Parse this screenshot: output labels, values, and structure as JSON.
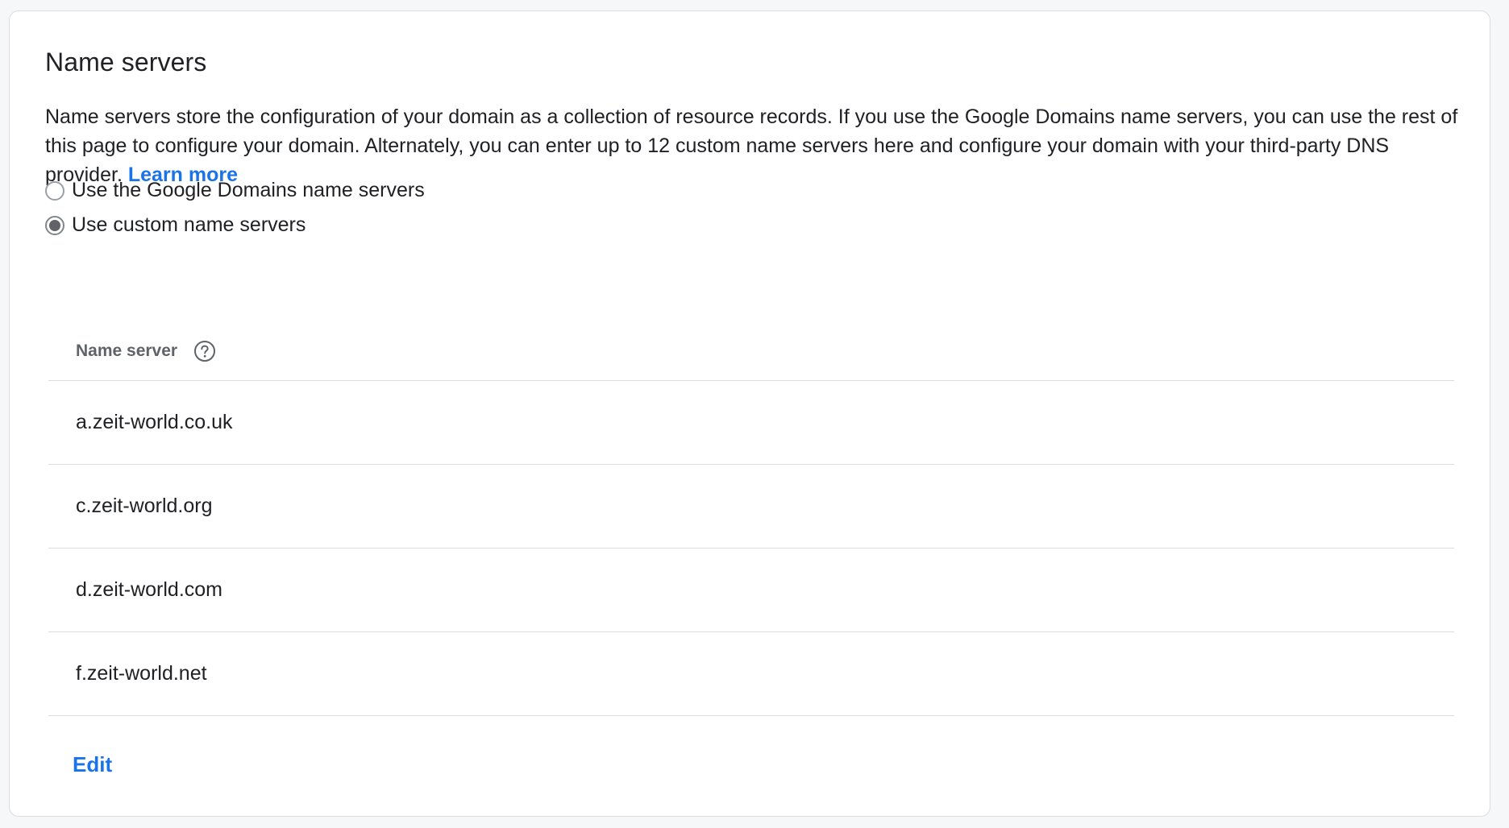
{
  "section": {
    "title": "Name servers",
    "description": "Name servers store the configuration of your domain as a collection of resource records. If you use the Google Domains name servers, you can use the rest of this page to configure your domain. Alternately, you can enter up to 12 custom name servers here and configure your domain with your third-party DNS provider.",
    "learn_more": "Learn more"
  },
  "options": [
    {
      "label": "Use the Google Domains name servers",
      "selected": false
    },
    {
      "label": "Use custom name servers",
      "selected": true
    }
  ],
  "table": {
    "header": "Name server",
    "header_icon": "help-circle-icon",
    "rows": [
      "a.zeit-world.co.uk",
      "c.zeit-world.org",
      "d.zeit-world.com",
      "f.zeit-world.net"
    ]
  },
  "actions": {
    "edit": "Edit"
  },
  "colors": {
    "accent": "#1a73e8",
    "text": "#202124",
    "muted": "#5f6368",
    "divider": "#dadce0"
  }
}
